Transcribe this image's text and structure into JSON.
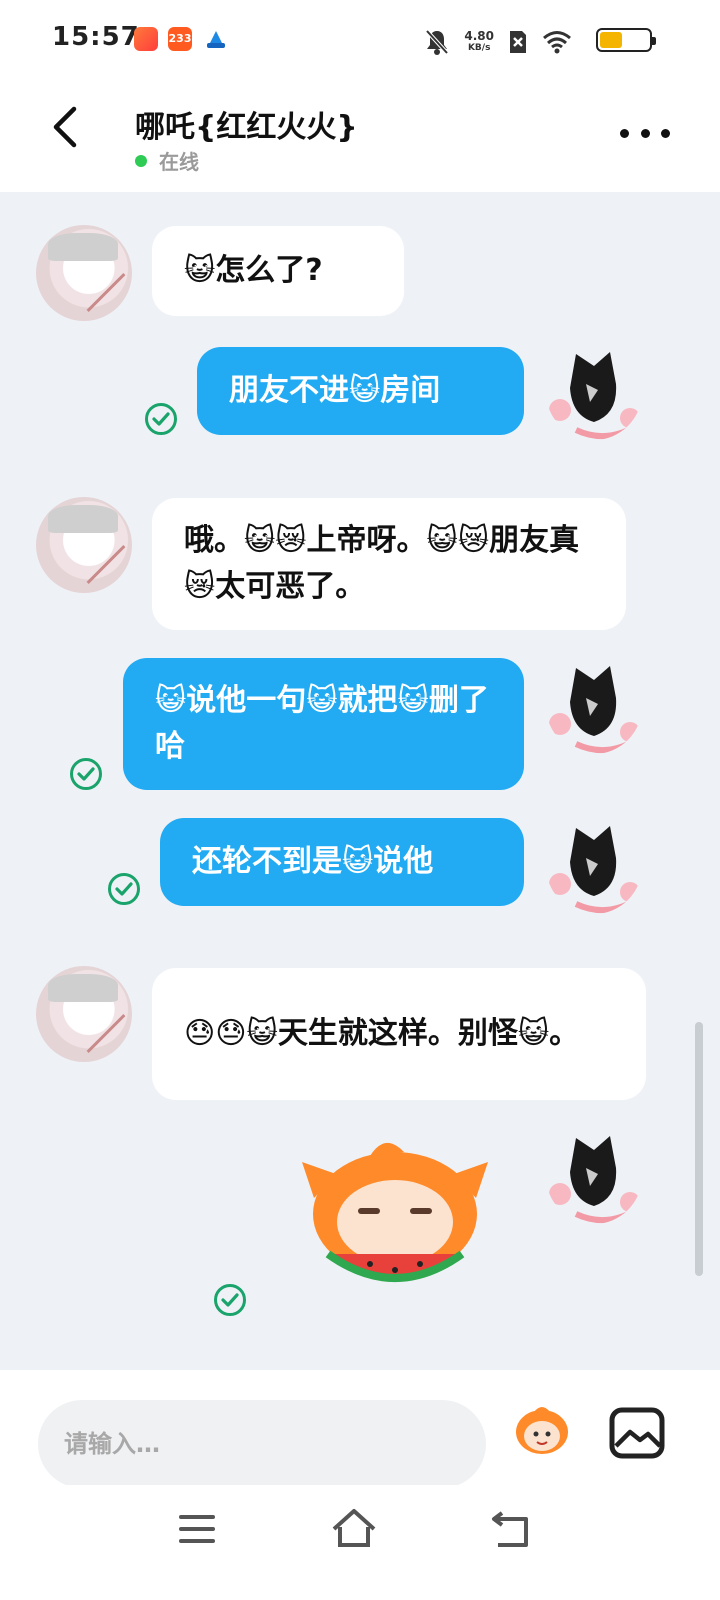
{
  "status_bar": {
    "time": "15:57",
    "net_speed_value": "4.80",
    "net_speed_unit": "KB/s",
    "battery_level": 0.45,
    "battery_color": "#f5b400",
    "app_icons": [
      "app-icon-1",
      "app-icon-233",
      "app-icon-3"
    ],
    "icons": [
      "notifications-muted-icon",
      "sim-off-icon",
      "wifi-icon",
      "battery-icon"
    ]
  },
  "header": {
    "contact_name": "哪吒{红红火火}",
    "status": "在线",
    "status_color": "#2ecc55"
  },
  "messages": [
    {
      "direction": "in",
      "text": "😺怎么了?"
    },
    {
      "direction": "out",
      "text": "朋友不进😺房间",
      "status": "sent"
    },
    {
      "direction": "in",
      "text": "哦。😺😿上帝呀。😺😿朋友真😿太可恶了。"
    },
    {
      "direction": "out",
      "text": "😺说他一句😺就把😺删了哈",
      "status": "sent"
    },
    {
      "direction": "out",
      "text": "还轮不到是😺说他",
      "status": "sent"
    },
    {
      "direction": "in",
      "text": "😓😓😺天生就这样。别怪😺。"
    },
    {
      "direction": "out",
      "type": "sticker",
      "sticker": "watermelon-eating-monkey-sticker",
      "status": "sent"
    }
  ],
  "colors": {
    "outgoing_bubble": "#22aaf2",
    "incoming_bubble": "#ffffff",
    "chat_background": "#eef2f6",
    "sent_tick": "#1aa36b"
  },
  "input": {
    "placeholder": "请输入…"
  },
  "nav": [
    "menu-icon",
    "home-icon",
    "back-icon"
  ]
}
